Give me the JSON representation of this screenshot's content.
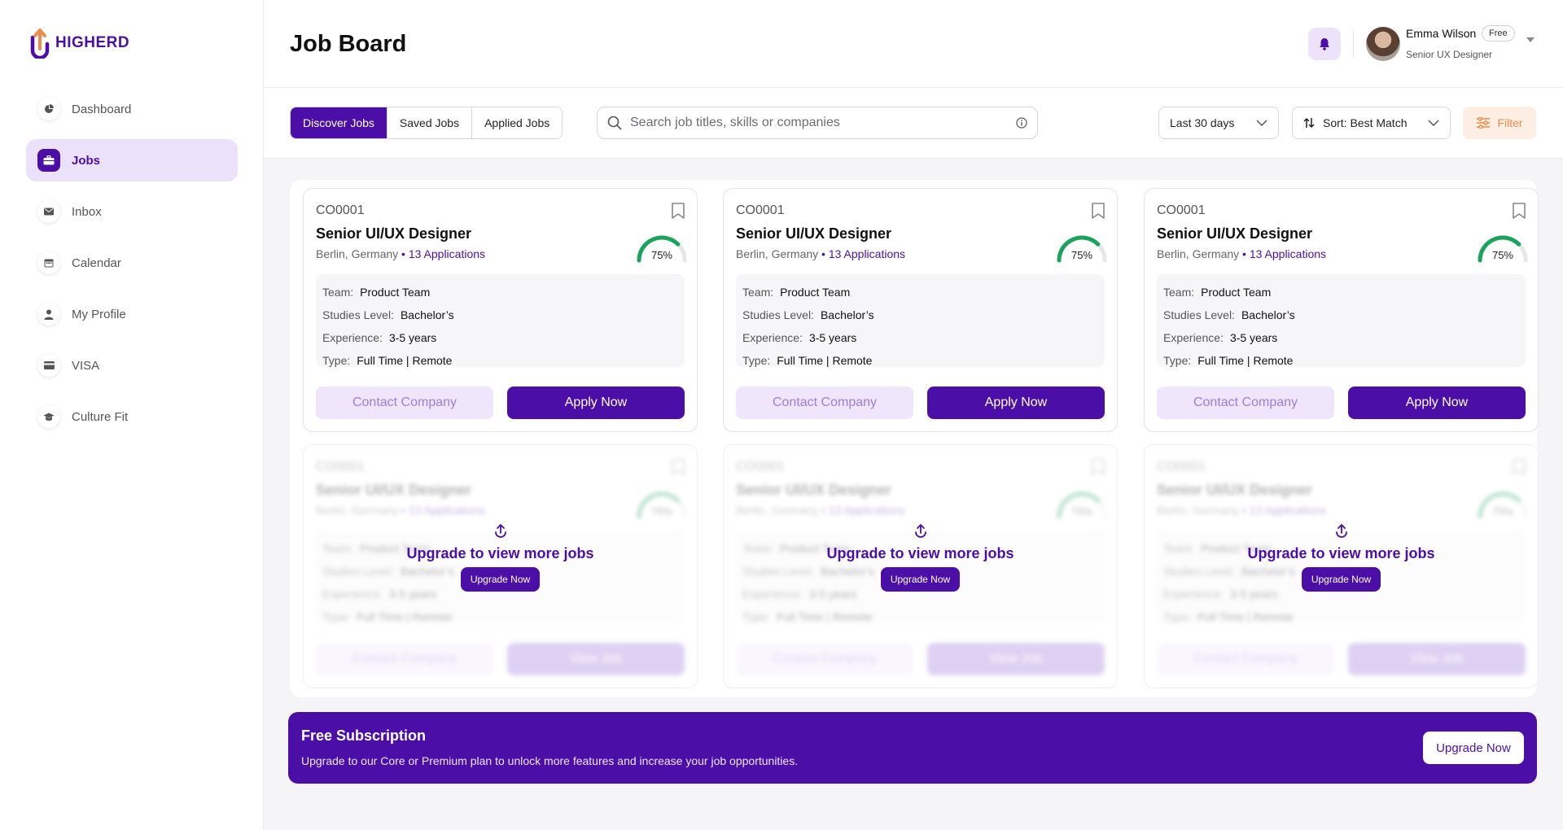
{
  "app": {
    "logo_text": "HIGHERD"
  },
  "sidebar": {
    "items": [
      {
        "label": "Dashboard",
        "icon": "pie-chart-icon",
        "active": false
      },
      {
        "label": "Jobs",
        "icon": "briefcase-icon",
        "active": true
      },
      {
        "label": "Inbox",
        "icon": "envelope-icon",
        "active": false
      },
      {
        "label": "Calendar",
        "icon": "calendar-icon",
        "active": false
      },
      {
        "label": "My Profile",
        "icon": "user-icon",
        "active": false
      },
      {
        "label": "VISA",
        "icon": "credit-card-icon",
        "active": false
      },
      {
        "label": "Culture Fit",
        "icon": "graduation-cap-icon",
        "active": false
      }
    ]
  },
  "header": {
    "title": "Job Board",
    "user": {
      "name": "Emma Wilson",
      "plan": "Free",
      "role": "Senior UX Designer"
    }
  },
  "toolbar": {
    "tabs": [
      {
        "label": "Discover Jobs",
        "active": true
      },
      {
        "label": "Saved Jobs",
        "active": false
      },
      {
        "label": "Applied Jobs",
        "active": false
      }
    ],
    "search_placeholder": "Search job titles, skills or companies",
    "date_range": "Last 30 days",
    "sort": "Sort: Best Match",
    "filter_label": "Filter"
  },
  "jobs": [
    {
      "code": "CO0001",
      "title": "Senior UI/UX Designer",
      "location": "Berlin, Germany",
      "applications": "13 Applications",
      "match": 75,
      "match_label": "75%",
      "team_label": "Team:",
      "team": "Product Team",
      "studies_label": "Studies Level:",
      "studies": "Bachelor’s",
      "experience_label": "Experience:",
      "experience": "3-5 years",
      "type_label": "Type:",
      "type": "Full Time | Remote",
      "contact_label": "Contact Company",
      "action_label": "Apply Now"
    },
    {
      "code": "CO0001",
      "title": "Senior UI/UX Designer",
      "location": "Berlin, Germany",
      "applications": "13 Applications",
      "match": 75,
      "match_label": "75%",
      "team_label": "Team:",
      "team": "Product Team",
      "studies_label": "Studies Level:",
      "studies": "Bachelor’s",
      "experience_label": "Experience:",
      "experience": "3-5 years",
      "type_label": "Type:",
      "type": "Full Time | Remote",
      "contact_label": "Contact Company",
      "action_label": "Apply Now"
    },
    {
      "code": "CO0001",
      "title": "Senior UI/UX Designer",
      "location": "Berlin, Germany",
      "applications": "13 Applications",
      "match": 75,
      "match_label": "75%",
      "team_label": "Team:",
      "team": "Product Team",
      "studies_label": "Studies Level:",
      "studies": "Bachelor’s",
      "experience_label": "Experience:",
      "experience": "3-5 years",
      "type_label": "Type:",
      "type": "Full Time | Remote",
      "contact_label": "Contact Company",
      "action_label": "Apply Now"
    }
  ],
  "locked_jobs": [
    {
      "code": "CO0001",
      "title": "Senior UI/UX Designer",
      "location": "Berlin, Germany",
      "applications": "13 Applications",
      "match": 75,
      "match_label": "75%",
      "team_label": "Team:",
      "team": "Product Team",
      "studies_label": "Studies Level:",
      "studies": "Bachelor’s",
      "experience_label": "Experience:",
      "experience": "3-5 years",
      "type_label": "Type:",
      "type": "Full Time | Remote",
      "contact_label": "Contact Company",
      "action_label": "View Job"
    },
    {
      "code": "CO0001",
      "title": "Senior UI/UX Designer",
      "location": "Berlin, Germany",
      "applications": "13 Applications",
      "match": 75,
      "match_label": "75%",
      "team_label": "Team:",
      "team": "Product Team",
      "studies_label": "Studies Level:",
      "studies": "Bachelor’s",
      "experience_label": "Experience:",
      "experience": "3-5 years",
      "type_label": "Type:",
      "type": "Full Time | Remote",
      "contact_label": "Contact Company",
      "action_label": "View Job"
    },
    {
      "code": "CO0001",
      "title": "Senior UI/UX Designer",
      "location": "Berlin, Germany",
      "applications": "13 Applications",
      "match": 75,
      "match_label": "75%",
      "team_label": "Team:",
      "team": "Product Team",
      "studies_label": "Studies Level:",
      "studies": "Bachelor’s",
      "experience_label": "Experience:",
      "experience": "3-5 years",
      "type_label": "Type:",
      "type": "Full Time | Remote",
      "contact_label": "Contact Company",
      "action_label": "View Job"
    }
  ],
  "upgrade_overlay": {
    "text": "Upgrade to view more jobs",
    "button": "Upgrade Now"
  },
  "banner": {
    "title": "Free Subscription",
    "text": "Upgrade to our Core or Premium plan to unlock more features and increase your job opportunities.",
    "button": "Upgrade Now"
  },
  "colors": {
    "brand": "#4b0fa8",
    "accent_orange": "#f08a4b",
    "match_green": "#1aa35a"
  }
}
